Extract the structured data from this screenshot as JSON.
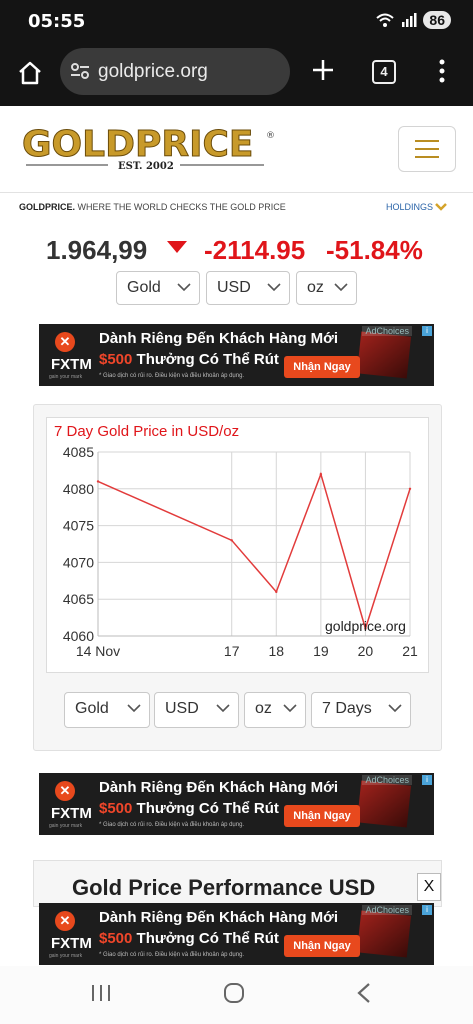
{
  "status": {
    "time": "05:55",
    "battery": "86",
    "icons": [
      "wifi-icon",
      "signal-icon",
      "battery-icon"
    ]
  },
  "browser": {
    "url": "goldprice.org",
    "tab_count": "4"
  },
  "site": {
    "logo_text": "GOLDPRICE",
    "logo_sub": "EST. 2002",
    "tagline_brand": "GOLDPRICE.",
    "tagline_rest": " WHERE THE WORLD CHECKS THE GOLD PRICE",
    "holdings": "HOLDINGS"
  },
  "price": {
    "value": "1.964,99",
    "change": "-2114.95",
    "change_pct": "-51.84%"
  },
  "selectors_top": {
    "metal": "Gold",
    "currency": "USD",
    "unit": "oz"
  },
  "ad": {
    "brand": "FXTM",
    "brand_sub": "gain your mark",
    "line1": "Dành Riêng Đến Khách Hàng Mới",
    "amount": "$500",
    "line2_rest": " Thưởng Có Thể Rút",
    "fine": "* Giao dịch có rủi ro. Điều kiện và điều khoản áp dụng.",
    "cta": "Nhận Ngay",
    "adchoices": "AdChoices"
  },
  "chart_data": {
    "type": "line",
    "title": "7 Day Gold Price in USD/oz",
    "x": [
      "14 Nov",
      "17",
      "18",
      "19",
      "20",
      "21"
    ],
    "x_numeric": [
      14,
      17,
      18,
      19,
      20,
      21
    ],
    "series": [
      {
        "x": [
          14,
          17,
          18,
          19,
          20,
          21
        ],
        "y": [
          4081,
          4073,
          4066,
          4082,
          4061,
          4080
        ]
      }
    ],
    "ylim": [
      4060,
      4085
    ],
    "yticks": [
      4060,
      4065,
      4070,
      4075,
      4080,
      4085
    ],
    "grid": true,
    "line_color": "#e23b3b",
    "watermark": "goldprice.org"
  },
  "selectors_chart": {
    "metal": "Gold",
    "currency": "USD",
    "unit": "oz",
    "period": "7 Days"
  },
  "performance": {
    "title": "Gold Price Performance USD",
    "close": "X"
  },
  "colors": {
    "accent_red": "#e0151a",
    "gold": "#b98d22",
    "link_blue": "#2a64a8"
  }
}
